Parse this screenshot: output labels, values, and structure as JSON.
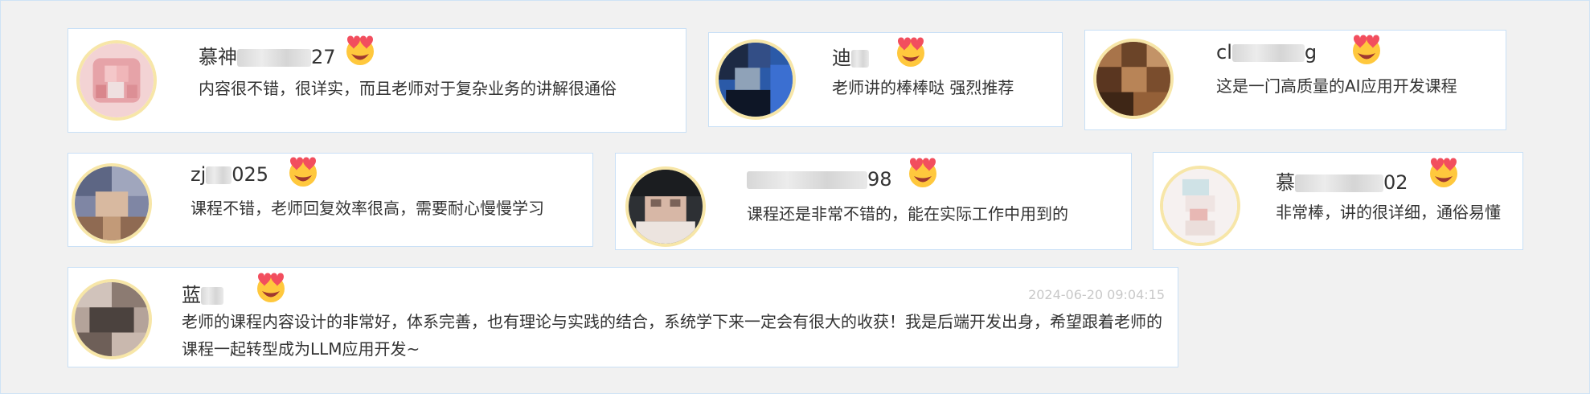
{
  "reviews": [
    {
      "name_prefix": "慕神",
      "name_suffix": "27",
      "comment": "内容很不错，很详实，而且老师对于复杂业务的讲解很通俗",
      "avatar_color": "#e6a3a8",
      "emoji": "heart-eyes-emoji"
    },
    {
      "name_prefix": "迪",
      "name_suffix": "",
      "comment": "老师讲的棒棒哒 强烈推荐",
      "avatar_color": "#1e3a6e",
      "emoji": "heart-eyes-emoji"
    },
    {
      "name_prefix": "cl",
      "name_suffix": "g",
      "comment": "这是一门高质量的AI应用开发课程",
      "avatar_color": "#6b4428",
      "emoji": "heart-eyes-emoji"
    },
    {
      "name_prefix": "zj",
      "name_suffix": "025",
      "comment": "课程不错，老师回复效率很高，需要耐心慢慢学习",
      "avatar_color": "#7f86a4",
      "emoji": "heart-eyes-emoji"
    },
    {
      "name_prefix": "",
      "name_suffix": "98",
      "comment": "课程还是非常不错的，能在实际工作中用到的",
      "avatar_color": "#2d3034",
      "emoji": "heart-eyes-emoji"
    },
    {
      "name_prefix": "慕",
      "name_suffix": "02",
      "comment": "非常棒，讲的很详细，通俗易懂",
      "avatar_color": "#efe4e2",
      "emoji": "heart-eyes-emoji"
    },
    {
      "name_prefix": "蓝",
      "name_suffix": "",
      "comment": "老师的课程内容设计的非常好，体系完善，也有理论与实践的结合，系统学下来一定会有很大的收获！我是后端开发出身，希望跟着老师的课程一起转型成为LLM应用开发~",
      "timestamp": "2024-06-20 09:04:15",
      "avatar_color": "#6e5f58",
      "emoji": "heart-eyes-emoji"
    }
  ],
  "colors": {
    "avatar_ring": "#f7e6a8",
    "card_border": "#c9e0f6",
    "board_bg": "#f1f1f1"
  }
}
